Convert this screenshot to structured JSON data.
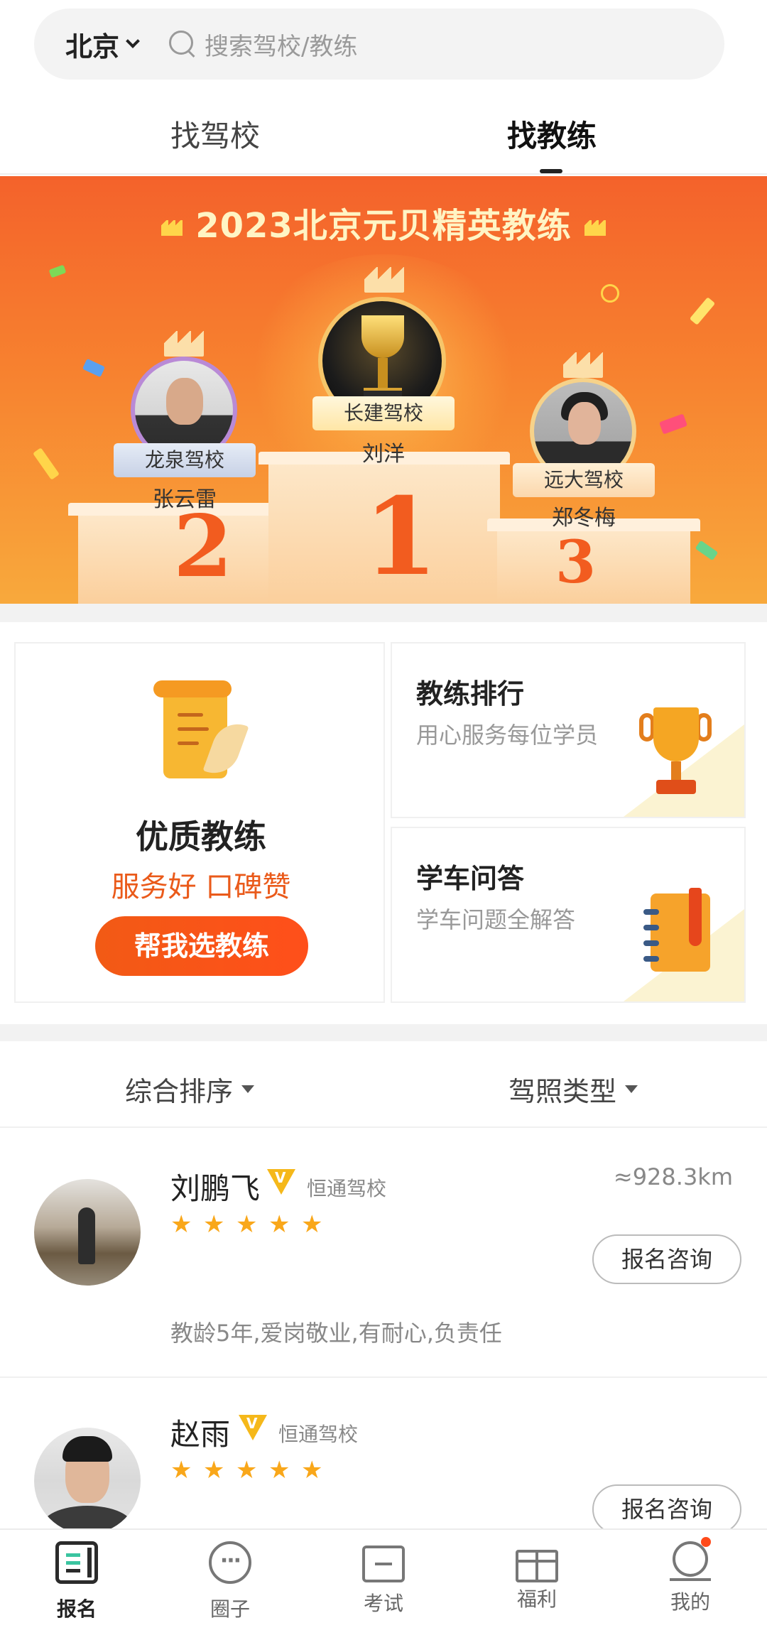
{
  "header": {
    "city": "北京",
    "search_placeholder": "搜索驾校/教练"
  },
  "tabs": [
    {
      "label": "找驾校",
      "active": false
    },
    {
      "label": "找教练",
      "active": true
    }
  ],
  "banner": {
    "title": "2023北京元贝精英教练",
    "podium": [
      {
        "rank": "1",
        "school": "长建驾校",
        "name": "刘洋"
      },
      {
        "rank": "2",
        "school": "龙泉驾校",
        "name": "张云雷"
      },
      {
        "rank": "3",
        "school": "远大驾校",
        "name": "郑冬梅"
      }
    ]
  },
  "features": {
    "quality": {
      "title": "优质教练",
      "subtitle": "服务好 口碑赞",
      "button": "帮我选教练",
      "icon": "scroll-document-icon"
    },
    "ranking": {
      "title": "教练排行",
      "subtitle": "用心服务每位学员",
      "icon": "trophy-icon"
    },
    "qa": {
      "title": "学车问答",
      "subtitle": "学车问题全解答",
      "icon": "notebook-icon"
    }
  },
  "filters": {
    "sort": "综合排序",
    "license": "驾照类型"
  },
  "coaches": [
    {
      "name": "刘鹏飞",
      "school": "恒通驾校",
      "distance": "≈928.3km",
      "stars": 5,
      "button": "报名咨询",
      "desc": "教龄5年,爱岗敬业,有耐心,负责任"
    },
    {
      "name": "赵雨",
      "school": "恒通驾校",
      "stars": 5,
      "button": "报名咨询"
    }
  ],
  "tabbar": [
    {
      "label": "报名",
      "icon": "register-icon",
      "active": true
    },
    {
      "label": "圈子",
      "icon": "chat-bubble-icon",
      "active": false
    },
    {
      "label": "考试",
      "icon": "exam-briefcase-icon",
      "active": false
    },
    {
      "label": "福利",
      "icon": "gift-icon",
      "active": false
    },
    {
      "label": "我的",
      "icon": "profile-icon",
      "active": false,
      "badge": true
    }
  ],
  "colors": {
    "accent": "#f25a15",
    "banner_top": "#f4622b",
    "banner_bottom": "#f8a93c",
    "star": "#f9a71a"
  }
}
